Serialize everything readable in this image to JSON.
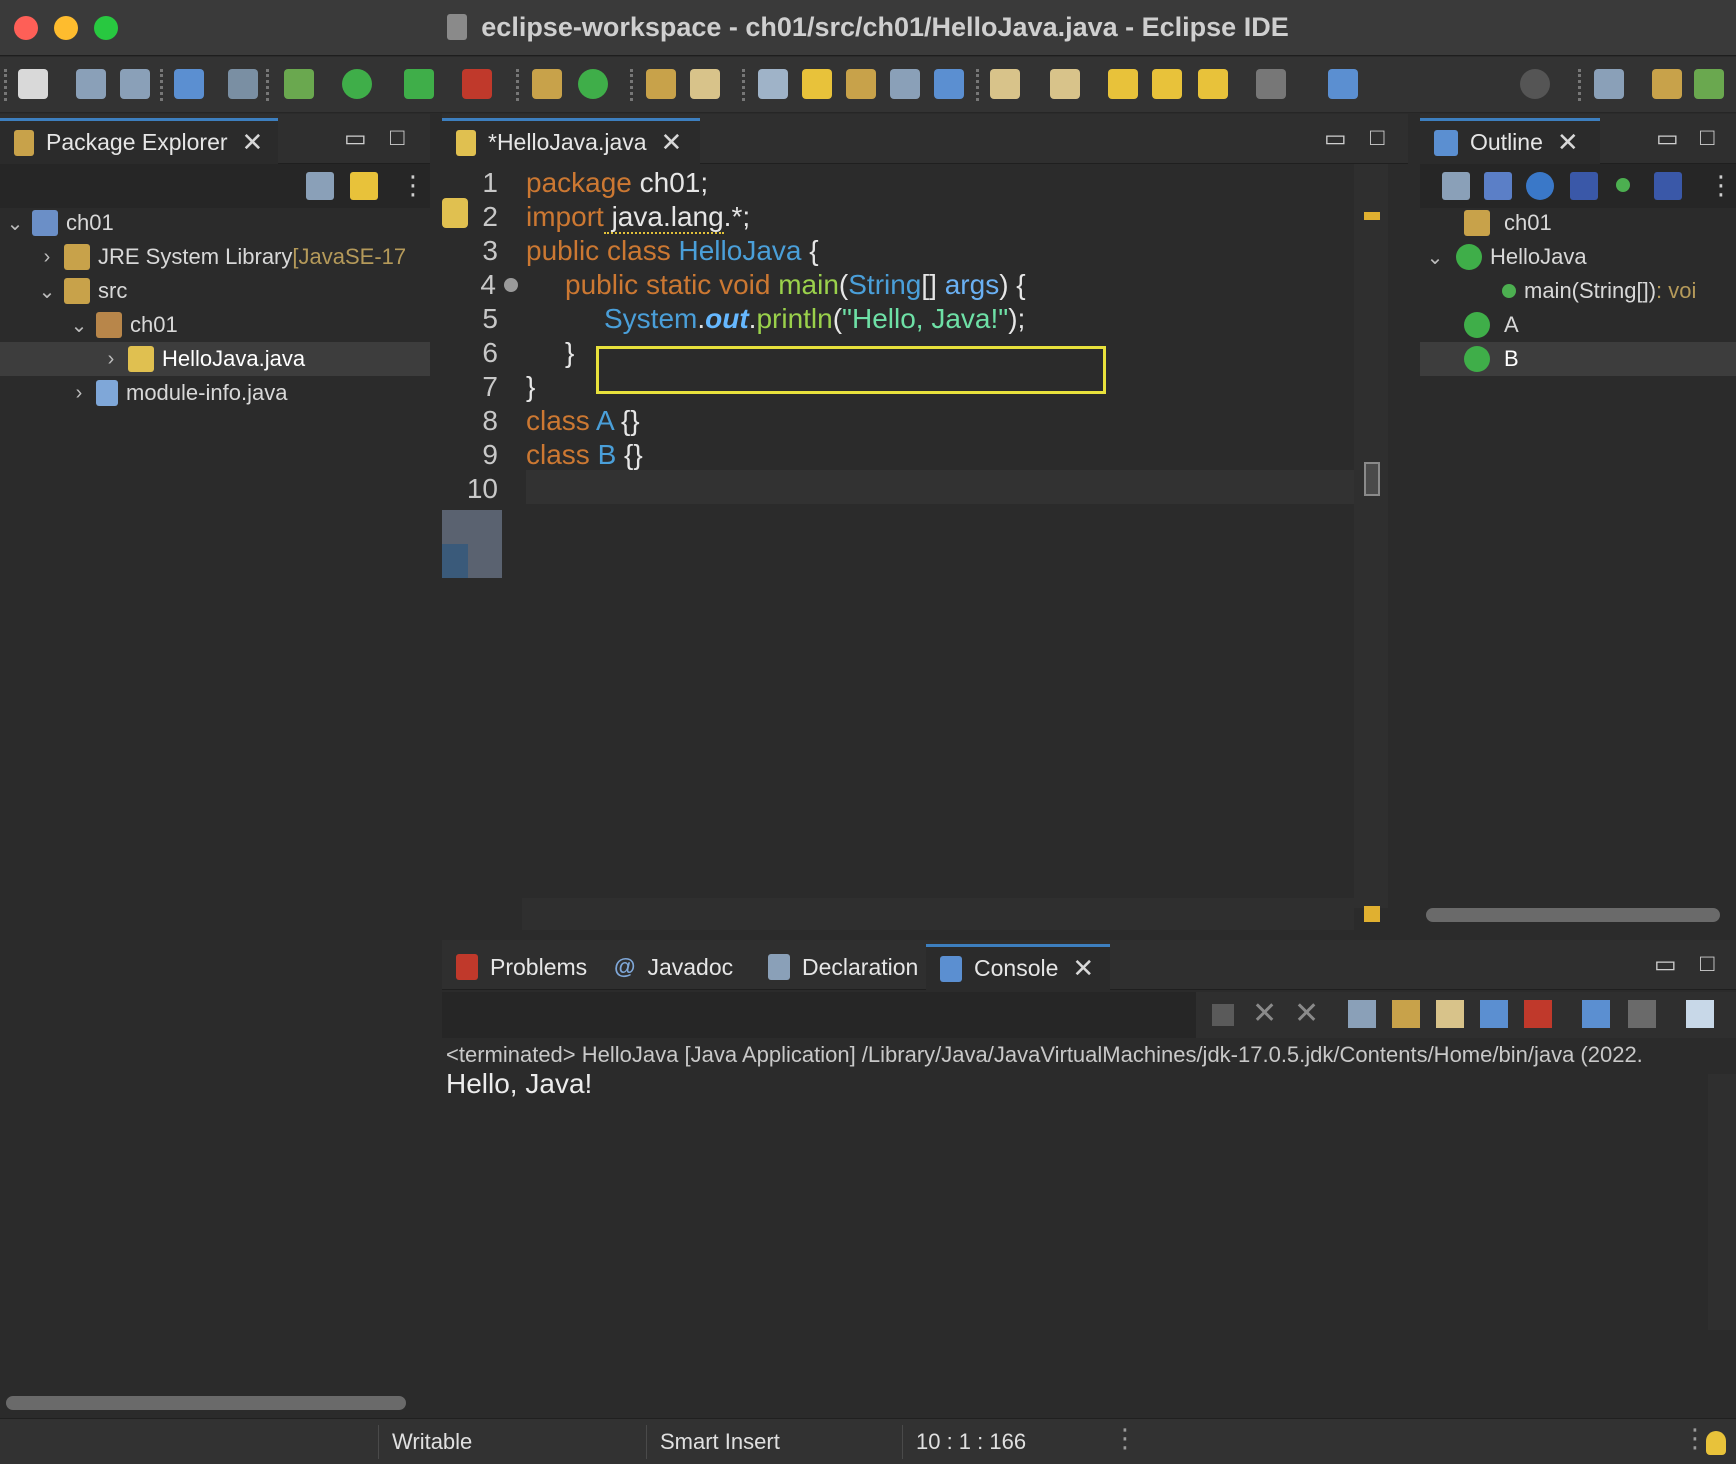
{
  "window": {
    "title": "eclipse-workspace - ch01/src/ch01/HelloJava.java - Eclipse IDE"
  },
  "package_explorer": {
    "tab_label": "Package Explorer",
    "tree": [
      {
        "label": "ch01",
        "suffix": ""
      },
      {
        "label": "JRE System Library",
        "suffix": " [JavaSE-17"
      },
      {
        "label": "src",
        "suffix": ""
      },
      {
        "label": "ch01",
        "suffix": ""
      },
      {
        "label": "HelloJava.java",
        "suffix": ""
      },
      {
        "label": "module-info.java",
        "suffix": ""
      }
    ]
  },
  "editor": {
    "tab_label": "*HelloJava.java",
    "line_numbers": [
      "1",
      "2",
      "3",
      "4",
      "5",
      "6",
      "7",
      "8",
      "9",
      "10"
    ],
    "lines": {
      "l1": [
        "package",
        " ch01;"
      ],
      "l2": [
        "import",
        " java.lang",
        ".*;"
      ],
      "l3": [
        "public class",
        " HelloJava",
        " {"
      ],
      "l4": [
        "public static void",
        " main",
        "(",
        "String",
        "[]",
        " args",
        ") {"
      ],
      "l5": [
        "System",
        ".",
        "out",
        ".",
        "println",
        "(",
        "\"Hello, Java!\"",
        ");"
      ],
      "l6": [
        "}"
      ],
      "l7": [
        "}"
      ],
      "l8": [
        "class",
        " A",
        " {}"
      ],
      "l9": [
        "class",
        " B",
        " {}"
      ]
    }
  },
  "outline": {
    "tab_label": "Outline",
    "items": [
      {
        "label": "ch01",
        "suffix": ""
      },
      {
        "label": "HelloJava",
        "suffix": ""
      },
      {
        "label": "main(String[])",
        "suffix": " : voi"
      },
      {
        "label": "A",
        "suffix": ""
      },
      {
        "label": "B",
        "suffix": ""
      }
    ]
  },
  "bottom_panel": {
    "tabs": [
      "Problems",
      "Javadoc",
      "Declaration",
      "Console"
    ],
    "console_header": "<terminated> HelloJava [Java Application] /Library/Java/JavaVirtualMachines/jdk-17.0.5.jdk/Contents/Home/bin/java  (2022.",
    "console_output": "Hello, Java!"
  },
  "statusbar": {
    "writable": "Writable",
    "insert_mode": "Smart Insert",
    "position": "10 : 1 : 166"
  },
  "colors": {
    "accent": "#3d7fbf",
    "highlight_box": "#e8e13c",
    "keyword": "#cc7832"
  }
}
